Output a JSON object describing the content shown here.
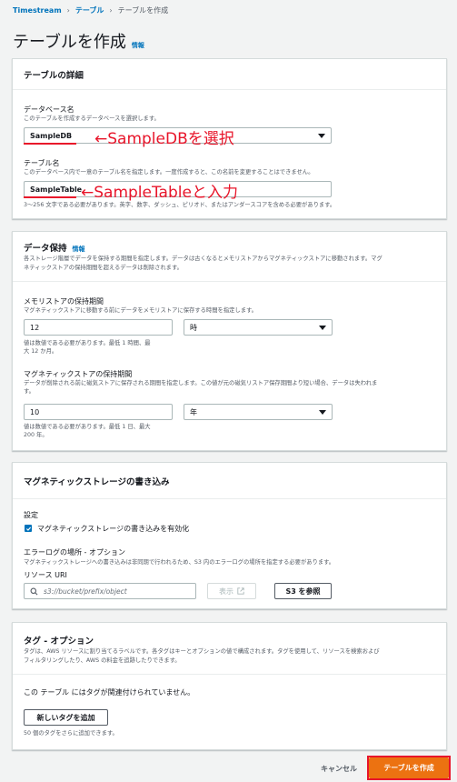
{
  "breadcrumb": {
    "root": "Timestream",
    "level2": "テーブル",
    "current": "テーブルを作成"
  },
  "page": {
    "title": "テーブルを作成",
    "info": "情報"
  },
  "details": {
    "heading": "テーブルの詳細",
    "db_label": "データベース名",
    "db_desc": "このテーブルを作成するデータベースを選択します。",
    "db_value": "SampleDB",
    "db_annotation": "←SampleDBを選択",
    "table_label": "テーブル名",
    "table_desc": "このデータベース内で一意のテーブル名を指定します。一度作成すると、この名前を変更することはできません。",
    "table_value": "SampleTable",
    "table_annotation": "←SampleTableと入力",
    "table_hint": "3～256 文字である必要があります。英字、数字、ダッシュ、ピリオド、またはアンダースコアを含める必要があります。"
  },
  "retention": {
    "heading": "データ保持",
    "info": "情報",
    "desc1": "各ストレージ階層でデータを保持する期間を指定します。データは古くなるとメモリストアからマグネティックストアに移動されます。マグ",
    "desc2": "ネティックストアの保持期間を超えるデータは削除されます。",
    "mem_label": "メモリストアの保持期間",
    "mem_desc": "マグネティックストアに移動する前にデータをメモリストアに保存する時間を指定します。",
    "mem_value": "12",
    "mem_unit": "時",
    "mem_hint1": "値は数値である必要があります。最低 1 時間、最",
    "mem_hint2": "大 12 か月。",
    "mag_label": "マグネティックストアの保持期間",
    "mag_desc1": "データが削除される前に磁気ストアに保存される期間を指定します。この値が元の磁気リストア保存期間より短い場合、データは失われま",
    "mag_desc2": "す。",
    "mag_value": "10",
    "mag_unit": "年",
    "mag_hint1": "値は数値である必要があります。最低 1 日、最大",
    "mag_hint2": "200 年。"
  },
  "magnetic": {
    "heading": "マグネティックストレージの書き込み",
    "settings_label": "設定",
    "checkbox_label": "マグネティックストレージの書き込みを有効化",
    "checked": true,
    "error_label": "エラーログの場所 - オプション",
    "error_desc": "マグネティックストレージへの書き込みは非同期で行われるため、S3 内のエラーログの場所を指定する必要があります。",
    "uri_label": "リソース URI",
    "uri_placeholder": "s3://bucket/prefix/object",
    "view_button": "表示",
    "browse_button": "S3 を参照"
  },
  "tags": {
    "heading": "タグ - オプション",
    "desc1": "タグは、AWS リソースに割り当てるラベルです。各タグはキーとオプションの値で構成されます。タグを使用して、リソースを検索および",
    "desc2": "フィルタリングしたり、AWS の料金を追跡したりできます。",
    "empty": "この テーブル にはタグが関連付けられていません。",
    "add_button": "新しいタグを追加",
    "hint": "50 個のタグをさらに追加できます。"
  },
  "footer": {
    "cancel": "キャンセル",
    "create": "テーブルを作成"
  },
  "colors": {
    "accent": "#0073bb",
    "primary": "#ec7211",
    "annotation": "#e8152a"
  }
}
